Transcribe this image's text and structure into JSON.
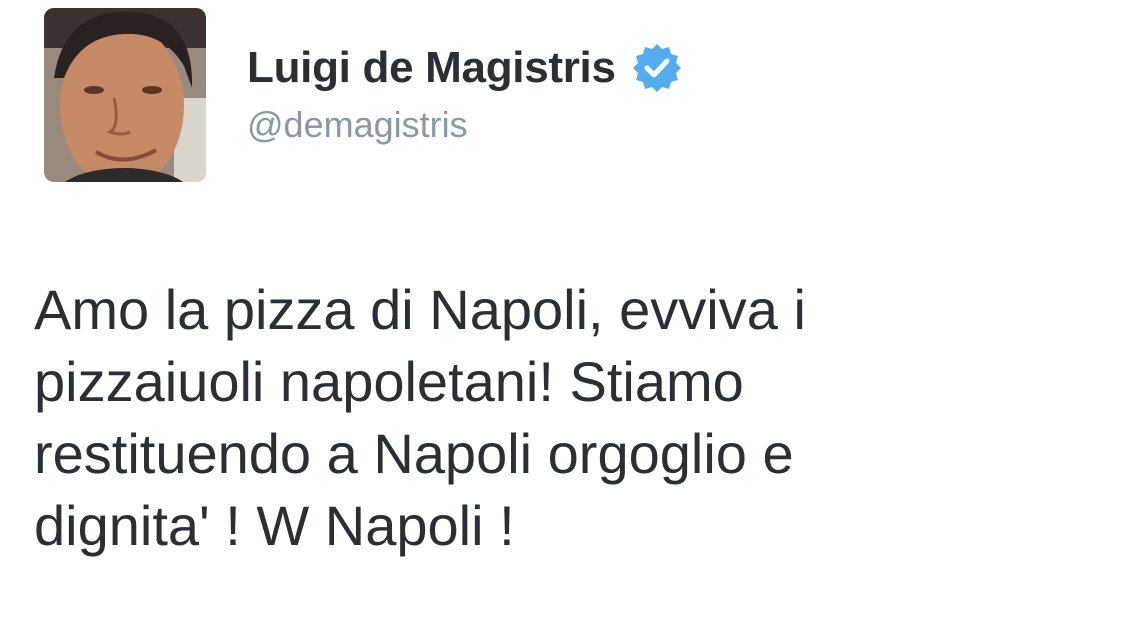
{
  "user": {
    "display_name": "Luigi de Magistris",
    "handle": "@demagistris",
    "verified": true,
    "avatar_icon": "profile-photo",
    "verified_icon": "verified-badge-icon"
  },
  "tweet": {
    "lines": [
      "Amo la pizza di Napoli, evviva i",
      "pizzaiuoli napoletani! Stiamo",
      "restituendo a Napoli orgoglio e",
      "dignita' ! W Napoli !"
    ]
  },
  "colors": {
    "name": "#292f33",
    "handle": "#8899a6",
    "verified": "#55acee",
    "text": "#292f33",
    "background": "#ffffff"
  }
}
